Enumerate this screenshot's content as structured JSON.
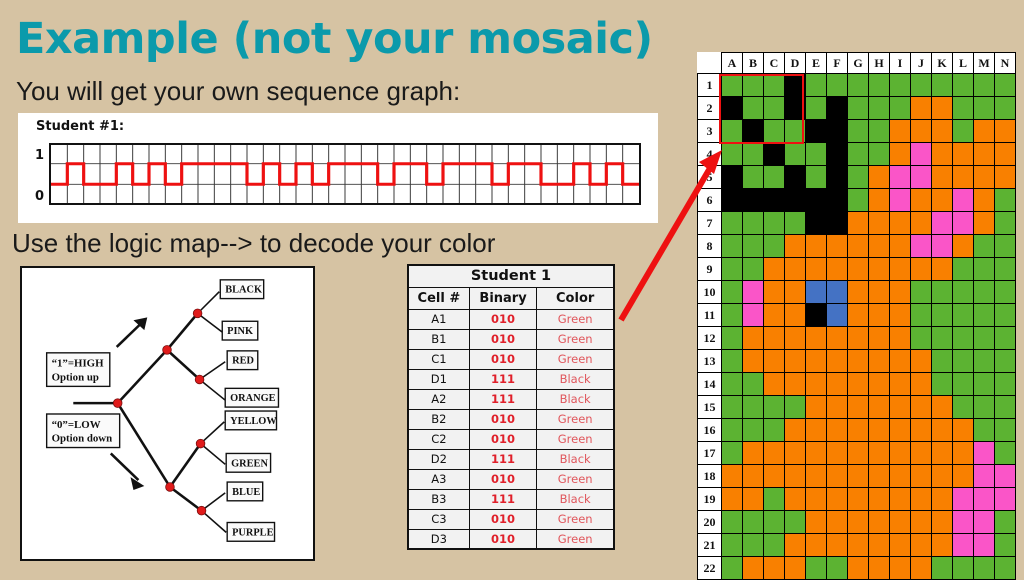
{
  "slide": {
    "title": "Example (not your mosaic)",
    "subtitle_1": "You will get your own sequence graph:",
    "subtitle_2": "Use the logic map--> to decode your color",
    "background_color": "#d6c3a3",
    "title_color": "#0b9aab"
  },
  "sequence_graph": {
    "student_label": "Student #1:",
    "axis_high": "1",
    "axis_low": "0",
    "line_color": "#ee1111",
    "columns": 36,
    "bits": [
      0,
      1,
      0,
      0,
      1,
      0,
      1,
      0,
      1,
      1,
      1,
      1,
      0,
      1,
      0,
      1,
      0,
      1,
      1,
      1,
      0,
      1,
      1,
      0,
      1,
      1,
      1,
      0,
      1,
      1,
      0,
      0,
      1,
      0,
      1,
      0
    ]
  },
  "logic_map": {
    "note_high": {
      "line1": "“1”=HIGH",
      "line2": "Option up"
    },
    "note_low": {
      "line1": "“0”=LOW",
      "line2": "Option down"
    },
    "leaves": [
      "BLACK",
      "PINK",
      "RED",
      "ORANGE",
      "YELLOW",
      "GREEN",
      "BLUE",
      "PURPLE"
    ],
    "node_color": "#e01b1b"
  },
  "decode_table": {
    "title": "Student 1",
    "headers": [
      "Cell #",
      "Binary",
      "Color"
    ],
    "rows": [
      {
        "cell": "A1",
        "binary": "010",
        "color": "Green"
      },
      {
        "cell": "B1",
        "binary": "010",
        "color": "Green"
      },
      {
        "cell": "C1",
        "binary": "010",
        "color": "Green"
      },
      {
        "cell": "D1",
        "binary": "111",
        "color": "Black"
      },
      {
        "cell": "A2",
        "binary": "111",
        "color": "Black"
      },
      {
        "cell": "B2",
        "binary": "010",
        "color": "Green"
      },
      {
        "cell": "C2",
        "binary": "010",
        "color": "Green"
      },
      {
        "cell": "D2",
        "binary": "111",
        "color": "Black"
      },
      {
        "cell": "A3",
        "binary": "010",
        "color": "Green"
      },
      {
        "cell": "B3",
        "binary": "111",
        "color": "Black"
      },
      {
        "cell": "C3",
        "binary": "010",
        "color": "Green"
      },
      {
        "cell": "D3",
        "binary": "010",
        "color": "Green"
      }
    ],
    "binary_color": "#e0202a",
    "color_text_color": "#e0565c"
  },
  "mosaic": {
    "column_headers": [
      "A",
      "B",
      "C",
      "D",
      "E",
      "F",
      "G",
      "H",
      "I",
      "J",
      "K",
      "L",
      "M",
      "N"
    ],
    "row_headers": [
      "1",
      "2",
      "3",
      "4",
      "5",
      "6",
      "7",
      "8",
      "9",
      "10",
      "11",
      "12",
      "13",
      "14",
      "15",
      "16",
      "17",
      "18",
      "19",
      "20",
      "21",
      "22"
    ],
    "palette": {
      "G": "#5cb332",
      "K": "#000000",
      "O": "#f98000",
      "P": "#fa55c8",
      "B": "#4472c4"
    },
    "highlight_region": "A1:D3",
    "highlight_color": "#ee1111",
    "grid": [
      [
        "G",
        "G",
        "G",
        "K",
        "G",
        "G",
        "G",
        "G",
        "G",
        "G",
        "G",
        "G",
        "G",
        "G"
      ],
      [
        "K",
        "G",
        "G",
        "K",
        "G",
        "K",
        "G",
        "G",
        "G",
        "O",
        "O",
        "G",
        "G",
        "G"
      ],
      [
        "G",
        "K",
        "G",
        "G",
        "K",
        "K",
        "G",
        "G",
        "O",
        "O",
        "O",
        "G",
        "O",
        "O"
      ],
      [
        "G",
        "G",
        "K",
        "G",
        "G",
        "K",
        "G",
        "G",
        "O",
        "P",
        "O",
        "O",
        "O",
        "O"
      ],
      [
        "K",
        "G",
        "G",
        "K",
        "G",
        "K",
        "G",
        "O",
        "P",
        "P",
        "O",
        "O",
        "O",
        "O"
      ],
      [
        "K",
        "K",
        "K",
        "K",
        "K",
        "K",
        "G",
        "O",
        "P",
        "O",
        "O",
        "P",
        "O",
        "G"
      ],
      [
        "G",
        "G",
        "G",
        "G",
        "K",
        "K",
        "O",
        "O",
        "O",
        "O",
        "P",
        "P",
        "O",
        "G"
      ],
      [
        "G",
        "G",
        "G",
        "O",
        "O",
        "O",
        "O",
        "O",
        "O",
        "P",
        "P",
        "O",
        "G",
        "G"
      ],
      [
        "G",
        "G",
        "O",
        "O",
        "O",
        "O",
        "O",
        "O",
        "O",
        "O",
        "O",
        "G",
        "G",
        "G"
      ],
      [
        "G",
        "P",
        "O",
        "O",
        "B",
        "B",
        "O",
        "O",
        "O",
        "G",
        "G",
        "G",
        "G",
        "G"
      ],
      [
        "G",
        "P",
        "O",
        "O",
        "K",
        "B",
        "O",
        "O",
        "O",
        "G",
        "G",
        "G",
        "G",
        "G"
      ],
      [
        "G",
        "O",
        "O",
        "O",
        "O",
        "O",
        "O",
        "O",
        "O",
        "G",
        "G",
        "G",
        "G",
        "G"
      ],
      [
        "G",
        "O",
        "O",
        "O",
        "O",
        "O",
        "O",
        "O",
        "O",
        "O",
        "G",
        "G",
        "G",
        "G"
      ],
      [
        "G",
        "G",
        "O",
        "O",
        "O",
        "O",
        "O",
        "O",
        "O",
        "O",
        "G",
        "G",
        "G",
        "G"
      ],
      [
        "G",
        "G",
        "G",
        "G",
        "O",
        "O",
        "O",
        "O",
        "O",
        "O",
        "O",
        "G",
        "G",
        "G"
      ],
      [
        "G",
        "G",
        "G",
        "O",
        "O",
        "O",
        "O",
        "O",
        "O",
        "O",
        "O",
        "O",
        "G",
        "G"
      ],
      [
        "G",
        "O",
        "O",
        "O",
        "O",
        "O",
        "O",
        "O",
        "O",
        "O",
        "O",
        "O",
        "P",
        "G"
      ],
      [
        "O",
        "O",
        "O",
        "O",
        "O",
        "O",
        "O",
        "O",
        "O",
        "O",
        "O",
        "O",
        "P",
        "P"
      ],
      [
        "O",
        "O",
        "G",
        "O",
        "O",
        "O",
        "O",
        "O",
        "O",
        "O",
        "O",
        "P",
        "P",
        "P"
      ],
      [
        "G",
        "G",
        "G",
        "G",
        "O",
        "O",
        "O",
        "O",
        "O",
        "O",
        "O",
        "P",
        "P",
        "G"
      ],
      [
        "G",
        "G",
        "G",
        "O",
        "O",
        "O",
        "O",
        "O",
        "O",
        "O",
        "O",
        "P",
        "P",
        "G"
      ],
      [
        "G",
        "O",
        "O",
        "O",
        "G",
        "G",
        "O",
        "O",
        "O",
        "O",
        "G",
        "G",
        "G",
        "G"
      ]
    ]
  }
}
